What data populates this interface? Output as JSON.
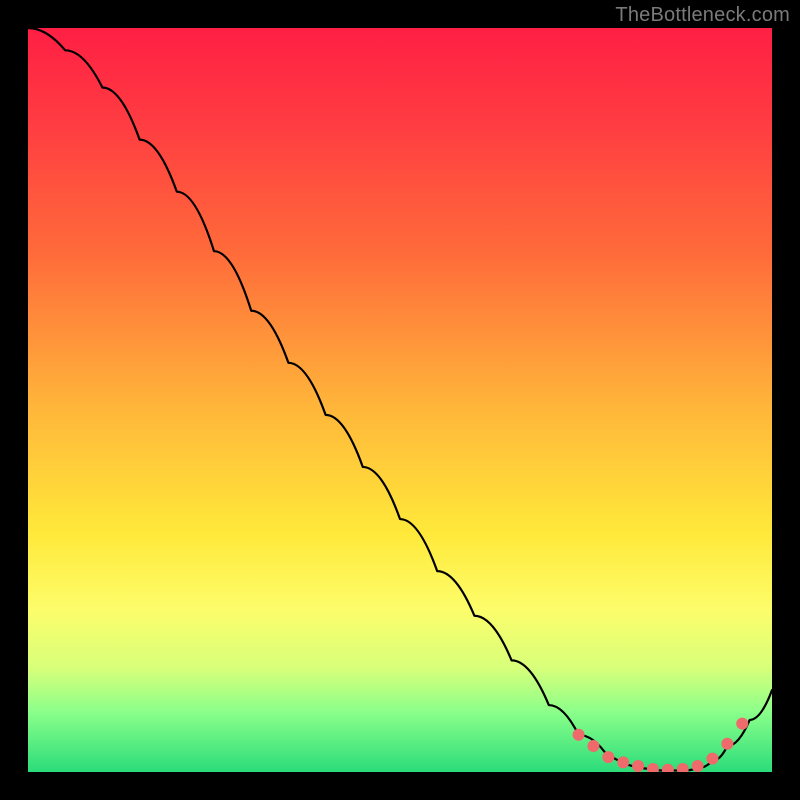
{
  "attribution": "TheBottleneck.com",
  "colors": {
    "background": "#000000",
    "gradient_top": "#ff1f44",
    "gradient_bottom": "#2bdc7a",
    "curve": "#000000",
    "dot": "#ef6a6a"
  },
  "chart_data": {
    "type": "line",
    "title": "",
    "xlabel": "",
    "ylabel": "",
    "xlim": [
      0,
      100
    ],
    "ylim": [
      0,
      100
    ],
    "x": [
      0,
      5,
      10,
      15,
      20,
      25,
      30,
      35,
      40,
      45,
      50,
      55,
      60,
      65,
      70,
      74,
      78,
      80,
      82,
      85,
      88,
      90,
      92,
      94,
      97,
      100
    ],
    "y": [
      100,
      97,
      92,
      85,
      78,
      70,
      62,
      55,
      48,
      41,
      34,
      27,
      21,
      15,
      9,
      5,
      2,
      1,
      0.5,
      0.2,
      0.2,
      0.5,
      1.5,
      3.5,
      7,
      11
    ],
    "highlight_x": [
      74,
      76,
      78,
      80,
      82,
      84,
      86,
      88,
      90,
      92,
      94,
      96
    ],
    "highlight_y": [
      5,
      3.5,
      2,
      1.3,
      0.8,
      0.4,
      0.3,
      0.4,
      0.8,
      1.8,
      3.8,
      6.5
    ]
  }
}
